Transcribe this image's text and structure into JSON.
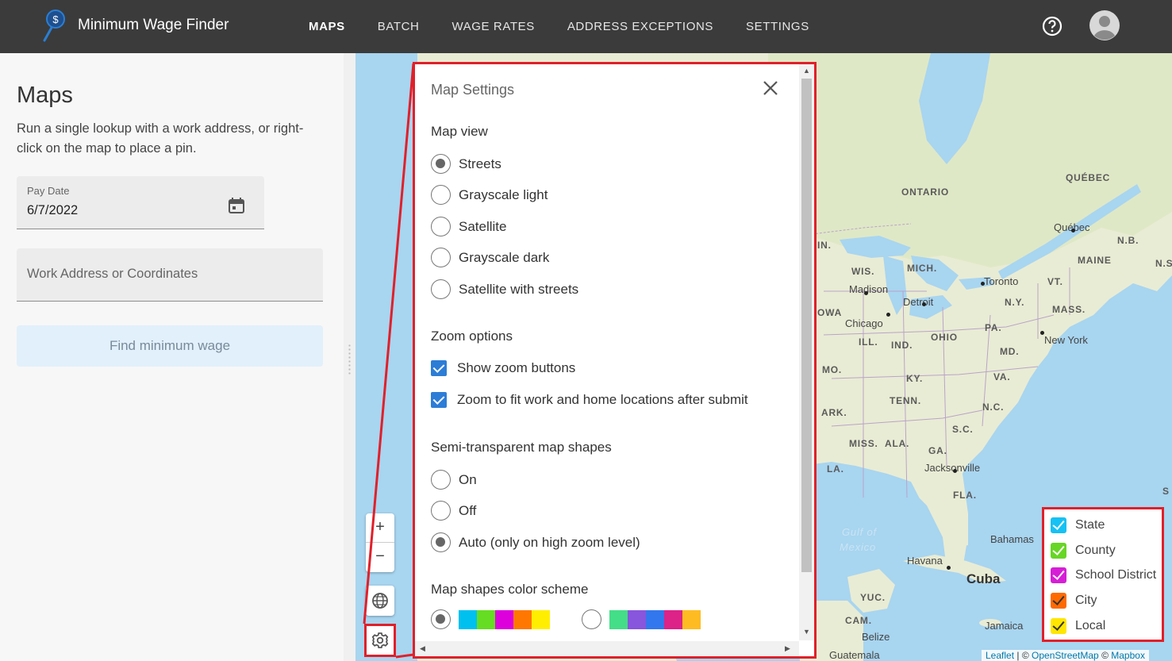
{
  "header": {
    "app_title": "Minimum Wage Finder",
    "nav": [
      {
        "label": "MAPS",
        "active": true
      },
      {
        "label": "BATCH",
        "active": false
      },
      {
        "label": "WAGE RATES",
        "active": false
      },
      {
        "label": "ADDRESS EXCEPTIONS",
        "active": false
      },
      {
        "label": "SETTINGS",
        "active": false
      }
    ],
    "icons": {
      "logo": "map-pin-dollar-icon",
      "help": "help-circle-icon",
      "avatar": "user-avatar-icon"
    }
  },
  "left_panel": {
    "title": "Maps",
    "description": "Run a single lookup with a work address, or right-click on the map to place a pin.",
    "pay_date": {
      "label": "Pay Date",
      "value": "6/7/2022"
    },
    "work_address": {
      "placeholder": "Work Address or Coordinates",
      "value": ""
    },
    "find_button": "Find minimum wage"
  },
  "map_controls": {
    "zoom_in": "+",
    "zoom_out": "−"
  },
  "map_labels": [
    {
      "text": "QUÉBEC",
      "kind": "strong"
    },
    {
      "text": "ONTARIO",
      "kind": "strong"
    },
    {
      "text": "Québec",
      "kind": "city"
    },
    {
      "text": "N.B.",
      "kind": "strong"
    },
    {
      "text": "MAINE",
      "kind": "strong"
    },
    {
      "text": "N.S",
      "kind": "strong"
    },
    {
      "text": "IN.",
      "kind": "strong"
    },
    {
      "text": "WIS.",
      "kind": "strong"
    },
    {
      "text": "MICH.",
      "kind": "strong"
    },
    {
      "text": "Madison",
      "kind": "city"
    },
    {
      "text": "Toronto",
      "kind": "city"
    },
    {
      "text": "VT.",
      "kind": "strong"
    },
    {
      "text": "Detroit",
      "kind": "city"
    },
    {
      "text": "N.Y.",
      "kind": "strong"
    },
    {
      "text": "MASS.",
      "kind": "strong"
    },
    {
      "text": "OWA",
      "kind": "strong"
    },
    {
      "text": "Chicago",
      "kind": "city"
    },
    {
      "text": "PA.",
      "kind": "strong"
    },
    {
      "text": "ILL.",
      "kind": "strong"
    },
    {
      "text": "IND.",
      "kind": "strong"
    },
    {
      "text": "OHIO",
      "kind": "strong"
    },
    {
      "text": "MD.",
      "kind": "strong"
    },
    {
      "text": "New York",
      "kind": "city"
    },
    {
      "text": "MO.",
      "kind": "strong"
    },
    {
      "text": "KY.",
      "kind": "strong"
    },
    {
      "text": "VA.",
      "kind": "strong"
    },
    {
      "text": "TENN.",
      "kind": "strong"
    },
    {
      "text": "ARK.",
      "kind": "strong"
    },
    {
      "text": "N.C.",
      "kind": "strong"
    },
    {
      "text": "S.C.",
      "kind": "strong"
    },
    {
      "text": "MISS.",
      "kind": "strong"
    },
    {
      "text": "ALA.",
      "kind": "strong"
    },
    {
      "text": "GA.",
      "kind": "strong"
    },
    {
      "text": "LA.",
      "kind": "strong"
    },
    {
      "text": "Jacksonville",
      "kind": "city"
    },
    {
      "text": "FLA.",
      "kind": "strong"
    },
    {
      "text": "Gulf of",
      "kind": "sea"
    },
    {
      "text": "Mexico",
      "kind": "sea"
    },
    {
      "text": "Bahamas",
      "kind": "city"
    },
    {
      "text": "Havana",
      "kind": "city"
    },
    {
      "text": "Cuba",
      "kind": "big"
    },
    {
      "text": "YUC.",
      "kind": "strong"
    },
    {
      "text": "CAM.",
      "kind": "strong"
    },
    {
      "text": "Belize",
      "kind": "city"
    },
    {
      "text": "Jamaica",
      "kind": "city"
    },
    {
      "text": "Guatemala",
      "kind": "city"
    },
    {
      "text": "S",
      "kind": "strong"
    }
  ],
  "settings_panel": {
    "title": "Map Settings",
    "map_view": {
      "label": "Map view",
      "options": [
        "Streets",
        "Grayscale light",
        "Satellite",
        "Grayscale dark",
        "Satellite with streets"
      ],
      "selected": "Streets"
    },
    "zoom_options": {
      "label": "Zoom options",
      "checks": [
        {
          "label": "Show zoom buttons",
          "checked": true
        },
        {
          "label": "Zoom to fit work and home locations after submit",
          "checked": true
        }
      ]
    },
    "semi_transparent": {
      "label": "Semi-transparent map shapes",
      "options": [
        "On",
        "Off",
        "Auto (only on high zoom level)"
      ],
      "selected": "Auto (only on high zoom level)"
    },
    "color_scheme": {
      "label": "Map shapes color scheme",
      "schemes": [
        {
          "selected": true,
          "colors": [
            "#00c0f0",
            "#66dd22",
            "#dd00dd",
            "#ff7700",
            "#ffee00"
          ]
        },
        {
          "selected": false,
          "colors": [
            "#44dd88",
            "#8855dd",
            "#3377ee",
            "#dd2288",
            "#ffbb22"
          ]
        }
      ]
    }
  },
  "legend": {
    "items": [
      {
        "label": "State",
        "color": "#16c1f3"
      },
      {
        "label": "County",
        "color": "#67d625"
      },
      {
        "label": "School District",
        "color": "#d61ed6"
      },
      {
        "label": "City",
        "color": "#ff6a00"
      },
      {
        "label": "Local",
        "color": "#ffe600"
      }
    ]
  },
  "attribution": {
    "leaflet": "Leaflet",
    "separator": "| ©",
    "osm": "OpenStreetMap",
    "mapbox_sep": "©",
    "mapbox": "Mapbox"
  }
}
